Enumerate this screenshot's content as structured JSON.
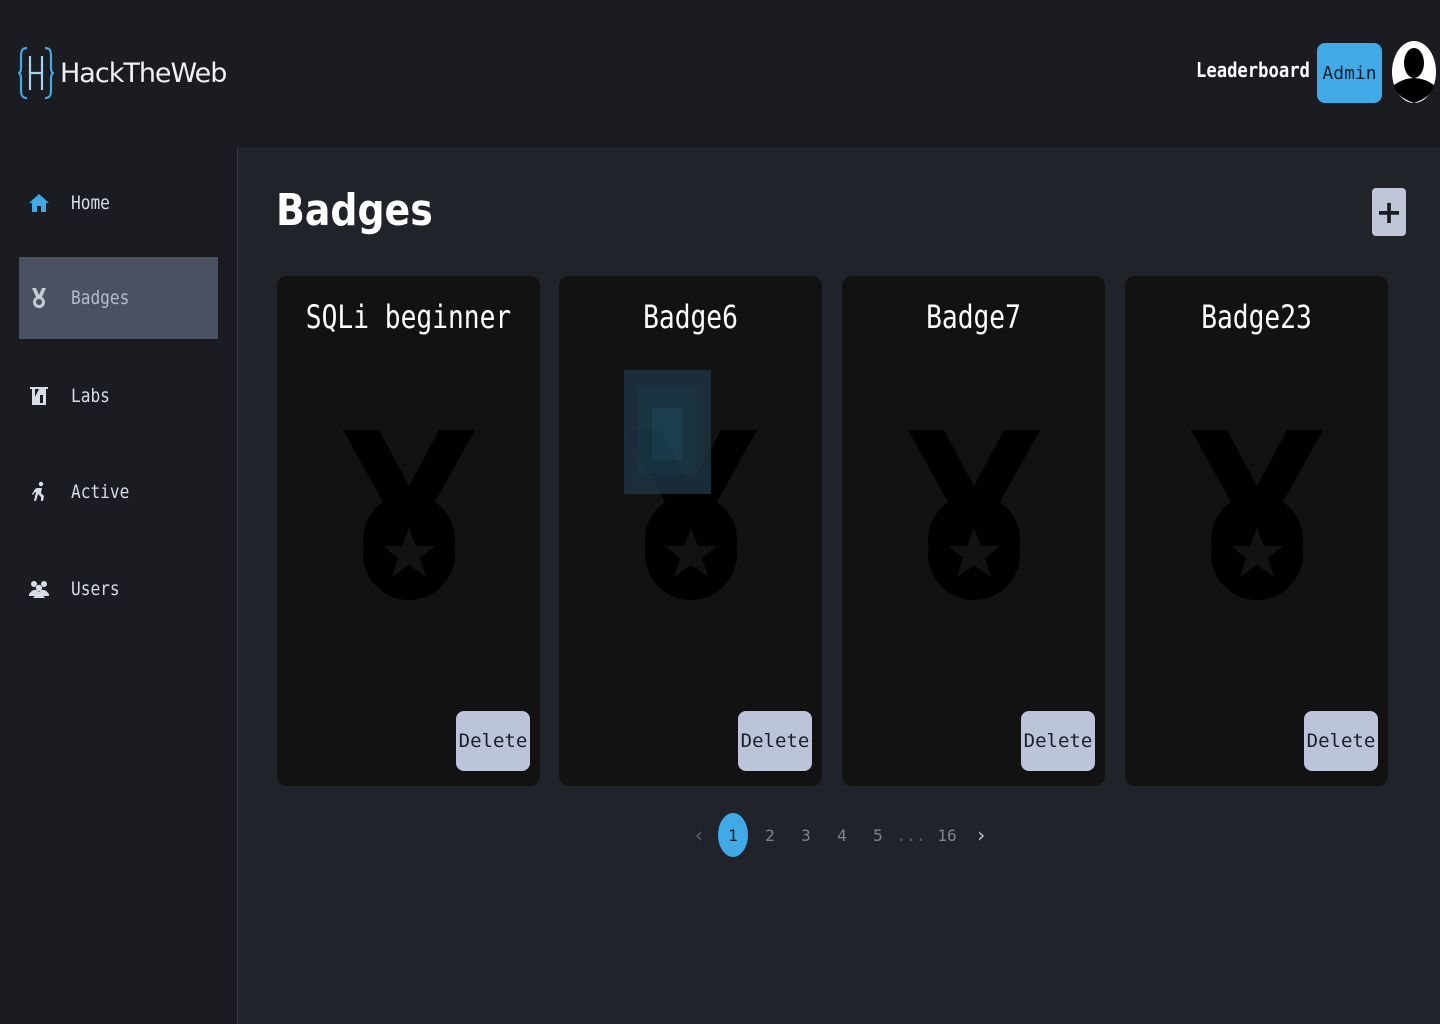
{
  "brand": {
    "name": "HackTheWeb",
    "accent": "#41a9e6"
  },
  "header": {
    "leaderboard_label": "Leaderboard",
    "admin_label": "Admin"
  },
  "sidebar": {
    "items": [
      {
        "label": "Home",
        "icon": "home-icon",
        "active": false
      },
      {
        "label": "Badges",
        "icon": "medal-icon",
        "active": true
      },
      {
        "label": "Labs",
        "icon": "flask-icon",
        "active": false
      },
      {
        "label": "Active",
        "icon": "running-icon",
        "active": false
      },
      {
        "label": "Users",
        "icon": "users-icon",
        "active": false
      }
    ]
  },
  "main": {
    "title": "Badges",
    "add_label": "+",
    "badges": [
      {
        "title": "SQLi beginner",
        "delete_label": "Delete"
      },
      {
        "title": "Badge6",
        "delete_label": "Delete"
      },
      {
        "title": "Badge7",
        "delete_label": "Delete"
      },
      {
        "title": "Badge23",
        "delete_label": "Delete"
      }
    ]
  },
  "pagination": {
    "prev": "‹",
    "pages": [
      "1",
      "2",
      "3",
      "4",
      "5"
    ],
    "ellipsis": "...",
    "last": "16",
    "next": "›",
    "current": "1"
  }
}
